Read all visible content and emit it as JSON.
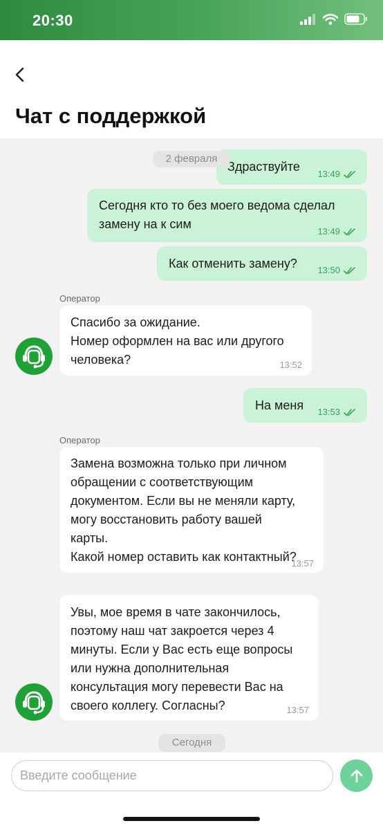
{
  "status_bar": {
    "time": "20:30"
  },
  "header": {
    "title": "Чат с поддержкой"
  },
  "chat": {
    "date_top": "2 февраля",
    "date_bottom": "Сегодня",
    "sender_label": "Оператор",
    "messages": [
      {
        "direction": "out",
        "text": "Здраствуйте",
        "time": "13:49",
        "status": "read"
      },
      {
        "direction": "out",
        "text": "Сегодня кто то без моего ведома сделал\nзамену на к сим",
        "time": "13:49",
        "status": "read"
      },
      {
        "direction": "out",
        "text": "Как отменить замену?",
        "time": "13:50",
        "status": "read"
      },
      {
        "direction": "in",
        "sender": "Оператор",
        "text": "Спасибо за ожидание.\nНомер оформлен на вас или другого\nчеловека?",
        "time": "13:52"
      },
      {
        "direction": "out",
        "text": "На меня",
        "time": "13:53",
        "status": "read"
      },
      {
        "direction": "in",
        "sender": "Оператор",
        "text": "Замена возможна только при личном\nобращении с соответствующим\nдокументом. Если вы не меняли карту,\nмогу восстановить работу вашей\nкарты.\nКакой номер оставить как контактный?",
        "time": "13:57"
      },
      {
        "direction": "in",
        "text": "Увы, мое время в чате закончилось,\nпоэтому наш чат закроется через 4\nминуты. Если у Вас есть еще вопросы\nили нужна дополнительная\nконсультация могу перевести Вас на\nсвоего коллегу. Согласны?",
        "time": "13:57"
      }
    ]
  },
  "input": {
    "placeholder": "Введите сообщение",
    "value": ""
  },
  "colors": {
    "brand": "#21a038",
    "outgoing_bubble": "#c9f2d6",
    "send_button": "#6fd29a",
    "status_bar": "#2e8b3e"
  },
  "icons": {
    "back": "chevron-left-icon",
    "read": "double-check-icon",
    "avatar": "operator-headset-icon",
    "send": "arrow-up-icon"
  }
}
